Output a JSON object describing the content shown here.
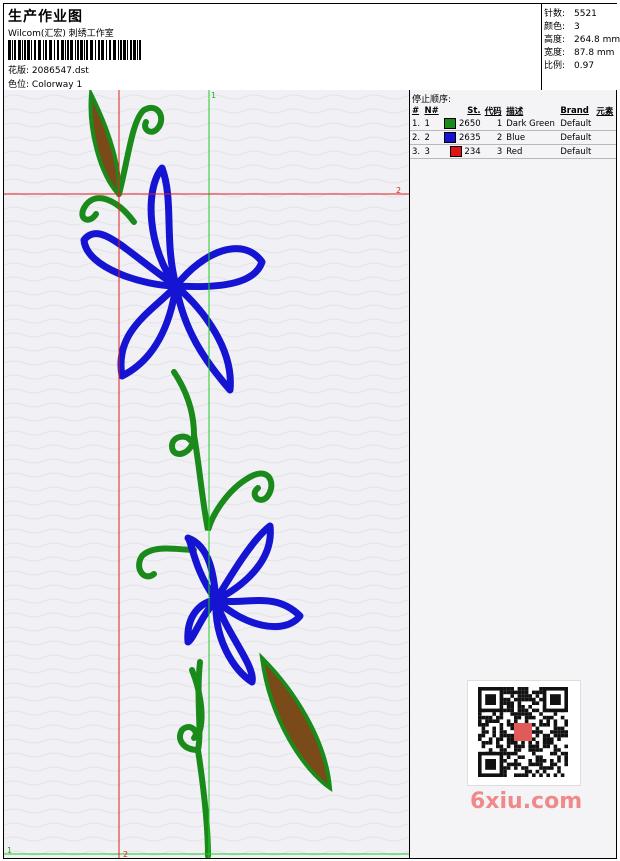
{
  "header": {
    "title": "生产作业图",
    "company": "Wilcom(汇宏) 刺绣工作室",
    "design_file_label": "花版:",
    "design_file": "2086547.dst",
    "colorway_label": "色位:",
    "colorway": "Colorway 1"
  },
  "stats": [
    {
      "label": "针数:",
      "value": "5521"
    },
    {
      "label": "颜色:",
      "value": "3"
    },
    {
      "label": "高度:",
      "value": "264.8 mm"
    },
    {
      "label": "宽度:",
      "value": "87.8 mm"
    },
    {
      "label": "比例:",
      "value": "0.97"
    }
  ],
  "stop_sequence": {
    "title": "停止顺序:",
    "columns": [
      "#",
      "N#",
      "St.",
      "代码",
      "描述",
      "Brand",
      "元素"
    ],
    "rows": [
      {
        "num": "1.",
        "n": "1",
        "color": "#1a8a1a",
        "st": "2650",
        "code": "1",
        "desc": "Dark Green",
        "brand": "Default"
      },
      {
        "num": "2.",
        "n": "2",
        "color": "#1414d2",
        "st": "2635",
        "code": "2",
        "desc": "Blue",
        "brand": "Default"
      },
      {
        "num": "3.",
        "n": "3",
        "color": "#e01414",
        "st": "234",
        "code": "3",
        "desc": "Red",
        "brand": "Default"
      }
    ]
  },
  "ruler_labels": {
    "top_green": "1",
    "right_red": "2",
    "bottom_green": "1",
    "bottom_red": "2"
  },
  "watermark": "6xiu.com",
  "colors": {
    "green": "#1a8a1a",
    "blue": "#1414d2",
    "red": "#e01414",
    "guide_green": "#22cc22",
    "guide_red": "#dd2222",
    "leaf_fill": "#8a4a18"
  }
}
